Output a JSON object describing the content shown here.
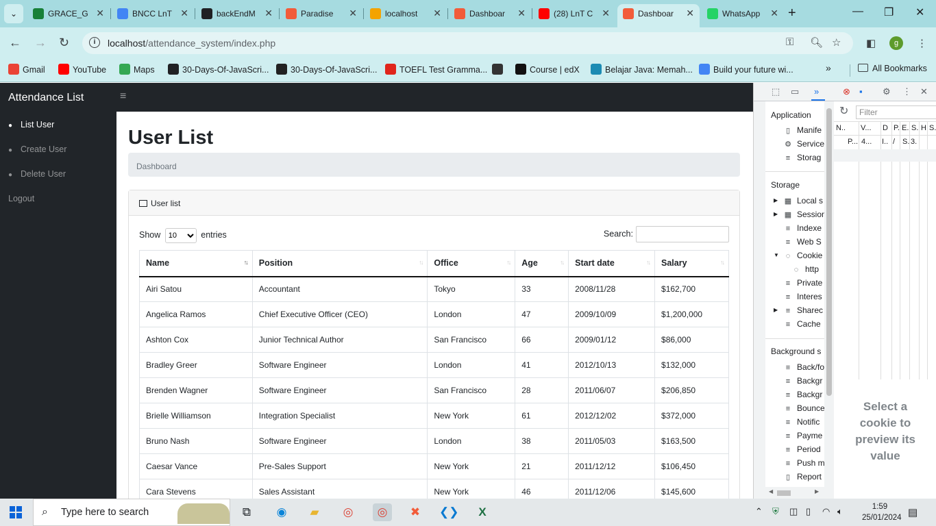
{
  "browser": {
    "tabs": [
      {
        "label": "GRACE_G",
        "icon": "sheets-icon",
        "color": "#188038"
      },
      {
        "label": "BNCC LnT",
        "icon": "docs-icon",
        "color": "#4285f4"
      },
      {
        "label": "backEndM",
        "icon": "github-icon",
        "color": "#202124"
      },
      {
        "label": "Paradise",
        "icon": "xampp-icon",
        "color": "#f25c3a"
      },
      {
        "label": "localhost",
        "icon": "phpmyadmin-icon",
        "color": "#f4a300"
      },
      {
        "label": "Dashboar",
        "icon": "xampp-icon",
        "color": "#f25c3a"
      },
      {
        "label": "(28) LnT C",
        "icon": "youtube-icon",
        "color": "#ff0000"
      },
      {
        "label": "Dashboar",
        "icon": "xampp-icon",
        "color": "#f25c3a",
        "active": true
      },
      {
        "label": "WhatsApp",
        "icon": "whatsapp-icon",
        "color": "#25d366"
      }
    ],
    "url_host": "localhost",
    "url_path": "/attendance_system/index.php",
    "profile_initial": "g",
    "bookmarks": [
      {
        "label": "Gmail",
        "icon": "gmail-icon",
        "color": "#ea4335"
      },
      {
        "label": "YouTube",
        "icon": "youtube-icon",
        "color": "#ff0000"
      },
      {
        "label": "Maps",
        "icon": "maps-icon",
        "color": "#34a853"
      },
      {
        "label": "30-Days-Of-JavaScri...",
        "icon": "github-icon",
        "color": "#202124"
      },
      {
        "label": "30-Days-Of-JavaScri...",
        "icon": "mt-icon",
        "color": "#222222"
      },
      {
        "label": "TOEFL Test Gramma...",
        "icon": "l-icon",
        "color": "#e0251b"
      },
      {
        "label": "",
        "icon": "globe-icon",
        "color": "#333333"
      },
      {
        "label": "Course | edX",
        "icon": "edx-icon",
        "color": "#111111"
      },
      {
        "label": "Belajar Java: Memah...",
        "icon": "dicoding-icon",
        "color": "#1c8bb3"
      },
      {
        "label": "Build your future wi...",
        "icon": "google-icon",
        "color": "#4285f4"
      }
    ],
    "all_bookmarks": "All Bookmarks"
  },
  "app": {
    "brand": "Attendance List",
    "nav": [
      {
        "label": "List User",
        "active": true
      },
      {
        "label": "Create User"
      },
      {
        "label": "Delete User"
      }
    ],
    "logout": "Logout",
    "page_title": "User List",
    "breadcrumb": "Dashboard",
    "card_title": "User list",
    "show_label": "Show",
    "entries_value": "10",
    "entries_label": "entries",
    "search_label": "Search:",
    "columns": [
      "Name",
      "Position",
      "Office",
      "Age",
      "Start date",
      "Salary"
    ],
    "rows": [
      [
        "Airi Satou",
        "Accountant",
        "Tokyo",
        "33",
        "2008/11/28",
        "$162,700"
      ],
      [
        "Angelica Ramos",
        "Chief Executive Officer (CEO)",
        "London",
        "47",
        "2009/10/09",
        "$1,200,000"
      ],
      [
        "Ashton Cox",
        "Junior Technical Author",
        "San Francisco",
        "66",
        "2009/01/12",
        "$86,000"
      ],
      [
        "Bradley Greer",
        "Software Engineer",
        "London",
        "41",
        "2012/10/13",
        "$132,000"
      ],
      [
        "Brenden Wagner",
        "Software Engineer",
        "San Francisco",
        "28",
        "2011/06/07",
        "$206,850"
      ],
      [
        "Brielle Williamson",
        "Integration Specialist",
        "New York",
        "61",
        "2012/12/02",
        "$372,000"
      ],
      [
        "Bruno Nash",
        "Software Engineer",
        "London",
        "38",
        "2011/05/03",
        "$163,500"
      ],
      [
        "Caesar Vance",
        "Pre-Sales Support",
        "New York",
        "21",
        "2011/12/12",
        "$106,450"
      ],
      [
        "Cara Stevens",
        "Sales Assistant",
        "New York",
        "46",
        "2011/12/06",
        "$145,600"
      ]
    ]
  },
  "devtools": {
    "application_header": "Application",
    "application_items": [
      "Manife",
      "Service",
      "Storag"
    ],
    "storage_header": "Storage",
    "storage_items": [
      "Local s",
      "Session",
      "Indexe",
      "Web S",
      "Cookie",
      "http",
      "Private",
      "Interes",
      "Sharec",
      "Cache"
    ],
    "background_header": "Background s",
    "background_items": [
      "Back/fo",
      "Backgr",
      "Backgr",
      "Bounce",
      "Notific",
      "Payme",
      "Period",
      "Push m",
      "Report"
    ],
    "filter_placeholder": "Filter",
    "grid_headers": [
      "N..",
      "V...",
      "D",
      "P.",
      "E.",
      "S.",
      "H",
      "S."
    ],
    "grid_row": [
      "P...",
      "4...",
      "I..",
      "/",
      "S.",
      "3."
    ],
    "preview_text": "Select a cookie to preview its value"
  },
  "taskbar": {
    "search_placeholder": "Type here to search",
    "time": "1:59",
    "date": "25/01/2024"
  }
}
